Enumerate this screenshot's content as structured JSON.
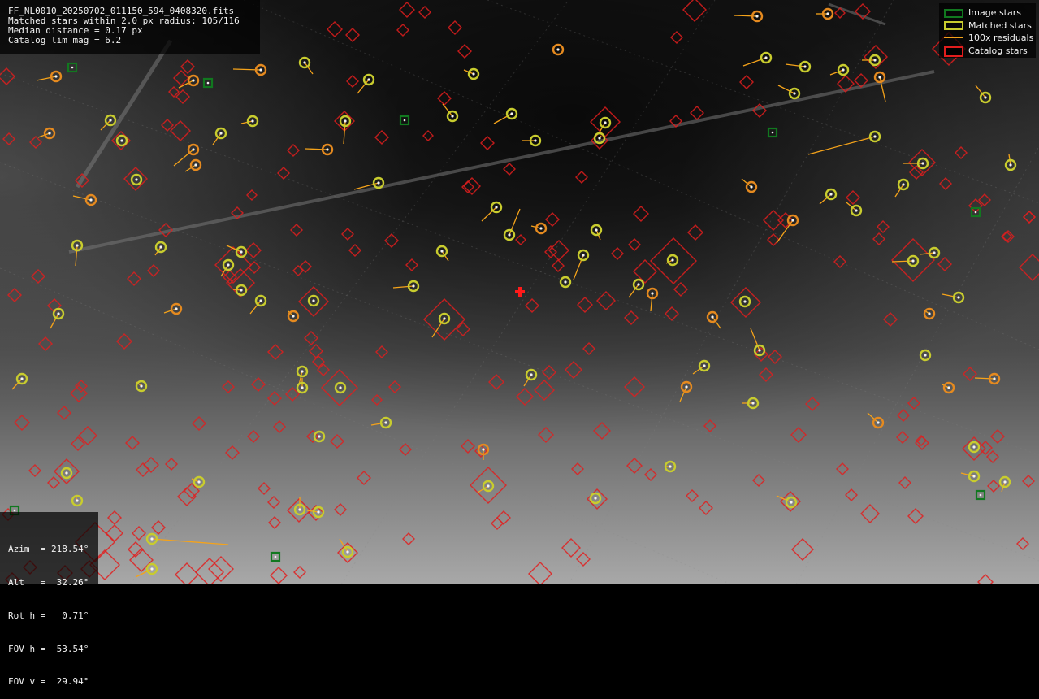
{
  "header": {
    "filename": "FF_NL0010_20250702_011150_594_0408320.fits",
    "matched_line": "Matched stars within 2.0 px radius: 105/116",
    "median_line": "Median distance = 0.17 px",
    "catalog_line": "Catalog lim mag = 6.2"
  },
  "legend": {
    "image_stars": "Image stars",
    "matched_stars": "Matched stars",
    "residuals": "100x residuals",
    "catalog_stars": "Catalog stars"
  },
  "pointing": {
    "azim": "Azim  = 218.54°",
    "alt": "Alt   =  32.26°",
    "rot": "Rot h =   0.71°",
    "fov_h": "FOV h =  53.54°",
    "fov_v": "FOV v =  29.94°"
  },
  "colors": {
    "image_star": "#11781f",
    "matched_star": "#c8cc2e",
    "residual": "#f5a31a",
    "catalog_star": "#e21d1d",
    "center_marker": "#ff1a1a"
  },
  "icons": {
    "center_marker": "red-cross-icon"
  }
}
